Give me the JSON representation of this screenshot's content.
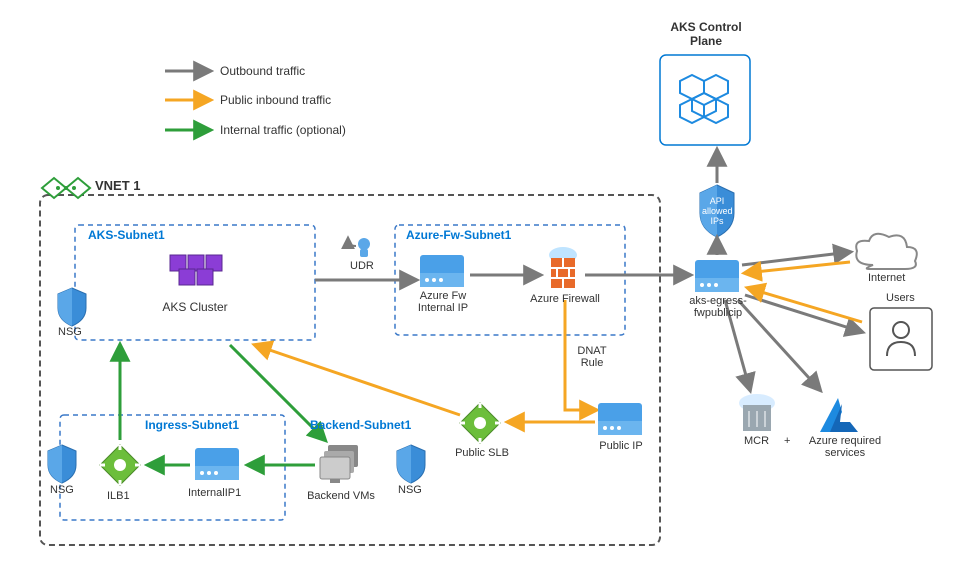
{
  "title": "AKS Control Plane",
  "legend": {
    "outbound": "Outbound traffic",
    "public_inbound": "Public inbound traffic",
    "internal": "Internal traffic (optional)"
  },
  "vnet": {
    "label": "VNET 1",
    "aks_subnet": {
      "label": "AKS-Subnet1",
      "cluster": "AKS Cluster",
      "nsg": "NSG"
    },
    "udr": "UDR",
    "fw_subnet": {
      "label": "Azure-Fw-Subnet1",
      "internal_ip": "Azure Fw Internal IP",
      "firewall": "Azure Firewall"
    },
    "ingress_subnet": {
      "label": "Ingress-Subnet1",
      "nsg": "NSG",
      "ilb": "ILB1",
      "internal_ip": "InternalIP1"
    },
    "backend_subnet": {
      "label": "Backend-Subnet1",
      "nsg": "NSG",
      "vms": "Backend VMs",
      "slb": "Public SLB",
      "public_ip": "Public IP"
    },
    "dnat": "DNAT Rule"
  },
  "egress": {
    "api_shield": "API allowed IPs",
    "public_ip": "aks-egress-fwpublicip",
    "internet": "Internet",
    "users": "Users",
    "mcr": "MCR",
    "plus": "+",
    "azure_services": "Azure required services"
  },
  "colors": {
    "outbound": "#7a7a7a",
    "inbound": "#f5a623",
    "internal": "#2e9e3a",
    "dashblue": "#3a78c8",
    "blue": "#0078d4"
  }
}
